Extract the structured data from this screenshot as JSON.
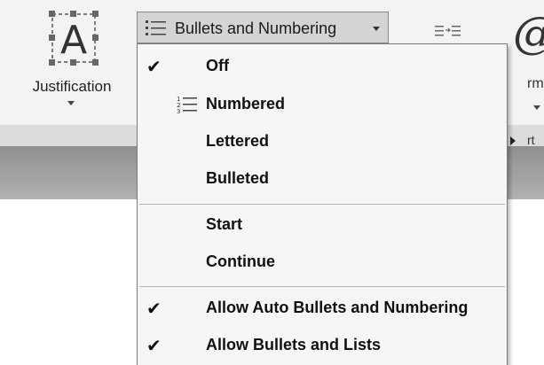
{
  "ribbon": {
    "justification": {
      "label": "Justification",
      "icon": "text-justification-icon"
    },
    "bullets_button": {
      "label": "Bullets and Numbering",
      "icon": "bulleted-list-icon"
    },
    "partial_label_fragment": "rm",
    "partial_label_fragment_2": "rt"
  },
  "menu": {
    "items": [
      {
        "label": "Off",
        "checked": true,
        "icon": ""
      },
      {
        "label": "Numbered",
        "checked": false,
        "icon": "numbered-list-icon"
      },
      {
        "label": "Lettered",
        "checked": false,
        "icon": "",
        "submenu": true
      },
      {
        "label": "Bulleted",
        "checked": false,
        "icon": ""
      },
      {
        "label": "Start",
        "checked": false,
        "icon": ""
      },
      {
        "label": "Continue",
        "checked": false,
        "icon": ""
      },
      {
        "label": "Allow Auto Bullets and Numbering",
        "checked": true,
        "icon": ""
      },
      {
        "label": "Allow Bullets and Lists",
        "checked": true,
        "icon": ""
      }
    ],
    "check_glyph": "✔"
  }
}
